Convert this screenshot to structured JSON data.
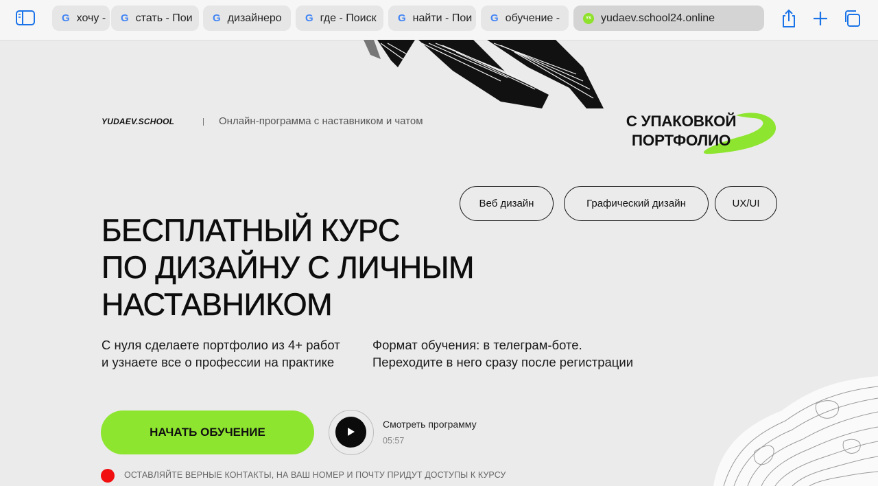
{
  "browser": {
    "tabs": [
      {
        "label": "хочу -",
        "favicon": "google-icon"
      },
      {
        "label": "стать - Пои",
        "favicon": "google-icon"
      },
      {
        "label": "дизайнеро",
        "favicon": "google-icon"
      },
      {
        "label": "где - Поиск",
        "favicon": "google-icon"
      },
      {
        "label": "найти - Пои",
        "favicon": "google-icon"
      },
      {
        "label": "обучение -",
        "favicon": "google-icon"
      }
    ],
    "active_tab": {
      "label": "yudaev.school24.online",
      "favicon": "yudaev-school-icon",
      "favicon_text": "YS"
    },
    "icons": [
      "sidebar-icon",
      "share-icon",
      "new-tab-plus-icon",
      "tab-overview-icon"
    ]
  },
  "header": {
    "logo": "YUDAEV.SCHOOL",
    "tagline": "Онлайн-программа с наставником и чатом"
  },
  "badge": {
    "line1": "С УПАКОВКОЙ",
    "line2": "ПОРТФОЛИО",
    "accent_color": "#8ee52f"
  },
  "categories": [
    "Веб дизайн",
    "Графический дизайн",
    "UX/UI"
  ],
  "headline": {
    "line1": "БЕСПЛАТНЫЙ КУРС",
    "line2": "ПО ДИЗАЙНУ С ЛИЧНЫМ",
    "line3": "НАСТАВНИКОМ"
  },
  "description": {
    "left_line1": "С нуля сделаете портфолио из 4+ работ",
    "left_line2": "и узнаете все о профессии на практике",
    "right_line1": "Формат обучения: в телеграм-боте.",
    "right_line2": "Переходите в него сразу после регистрации"
  },
  "cta": {
    "start_label": "НАЧАТЬ ОБУЧЕНИЕ",
    "color": "#8ee52f"
  },
  "video": {
    "label": "Смотреть программу",
    "duration": "05:57"
  },
  "notice": {
    "text": "ОСТАВЛЯЙТЕ ВЕРНЫЕ КОНТАКТЫ, НА ВАШ НОМЕР И ПОЧТУ ПРИДУТ ДОСТУПЫ К КУРСУ",
    "dot_color": "#f20f0f"
  }
}
